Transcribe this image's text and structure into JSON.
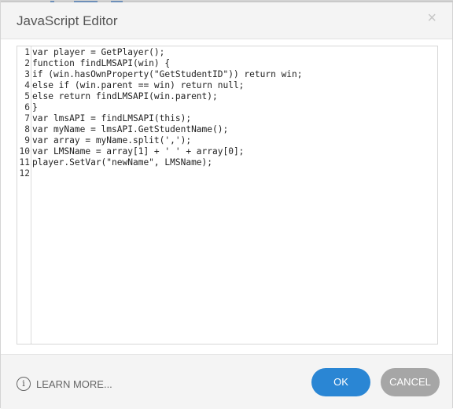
{
  "dialog": {
    "title": "JavaScript Editor",
    "close_glyph": "×"
  },
  "editor": {
    "line_numbers": [
      "1",
      "2",
      "3",
      "4",
      "5",
      "6",
      "7",
      "8",
      "9",
      "10",
      "11",
      "12"
    ],
    "lines": [
      "var player = GetPlayer();",
      "function findLMSAPI(win) {",
      "if (win.hasOwnProperty(\"GetStudentID\")) return win;",
      "else if (win.parent == win) return null;",
      "else return findLMSAPI(win.parent);",
      "}",
      "var lmsAPI = findLMSAPI(this);",
      "var myName = lmsAPI.GetStudentName();",
      "var array = myName.split(',');",
      "var LMSName = array[1] + ' ' + array[0];",
      "player.SetVar(\"newName\", LMSName);",
      ""
    ]
  },
  "footer": {
    "learn_more": "LEARN MORE...",
    "info_glyph": "i",
    "ok_label": "OK",
    "cancel_label": "CANCEL"
  },
  "colors": {
    "ok_button": "#2a86d4",
    "cancel_button": "#a6a6a6",
    "title_bar": "#f4f4f4"
  }
}
